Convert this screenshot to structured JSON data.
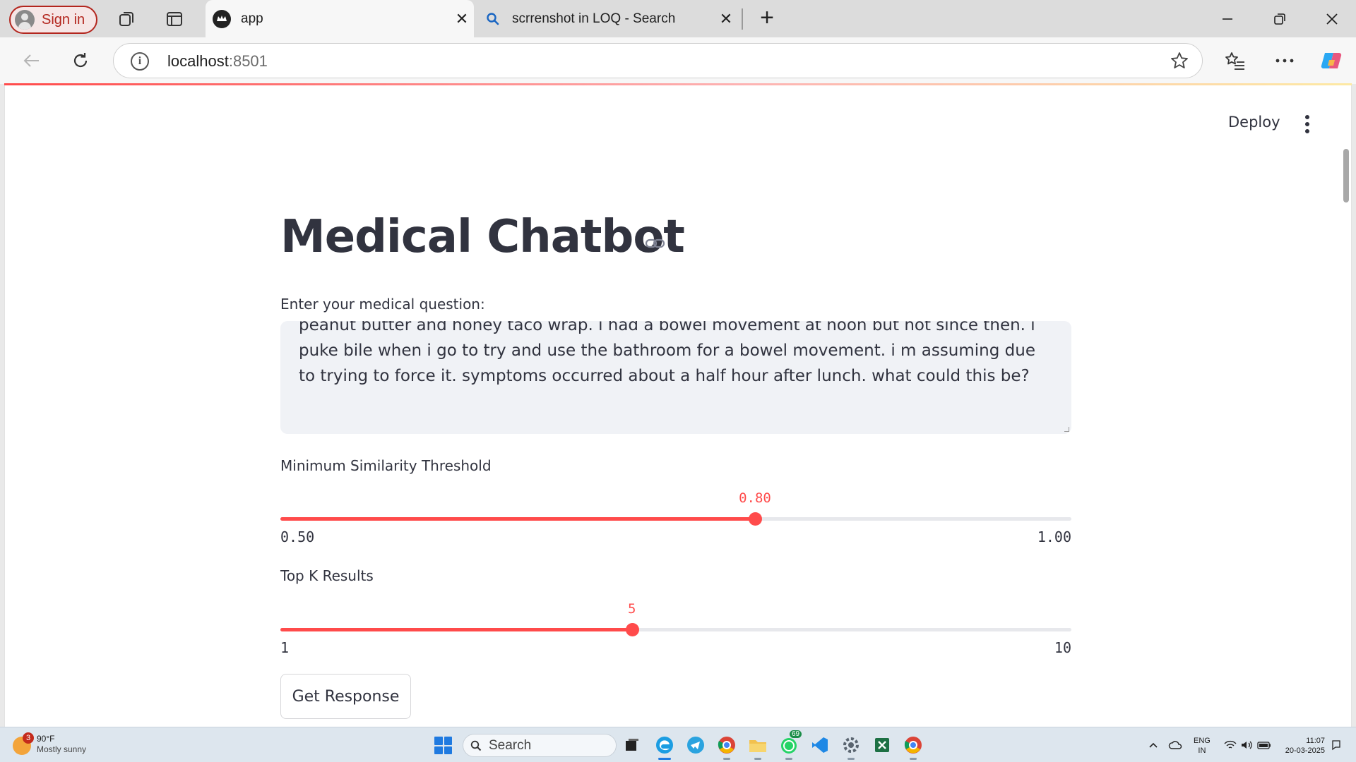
{
  "browser": {
    "profile_label": "Sign in",
    "tabs": [
      {
        "title": "app",
        "active": true,
        "icon": "streamlit-crown-icon"
      },
      {
        "title": "scrrenshot in LOQ - Search",
        "active": false,
        "icon": "search-icon"
      }
    ],
    "url_host": "localhost",
    "url_port": ":8501"
  },
  "app": {
    "deploy_label": "Deploy",
    "title": "Medical Chatbot",
    "question_label": "Enter your medical question:",
    "question_value": "peanut butter and honey taco wrap. i had a bowel movement at noon but not since then. i puke bile when i go to try and use the bathroom for a bowel movement. i m assuming due to trying to force it. symptoms occurred about a half hour after lunch. what could this be?",
    "similarity": {
      "label": "Minimum Similarity Threshold",
      "value_text": "0.80",
      "value": 0.8,
      "min_text": "0.50",
      "max_text": "1.00",
      "min": 0.5,
      "max": 1.0,
      "accent": "#ff4b4b"
    },
    "topk": {
      "label": "Top K Results",
      "value_text": "5",
      "value": 5,
      "min_text": "1",
      "max_text": "10",
      "min": 1,
      "max": 10,
      "accent": "#ff4b4b"
    },
    "button_label": "Get Response"
  },
  "taskbar": {
    "weather_badge": "3",
    "weather_temp": "90°F",
    "weather_cond": "Mostly sunny",
    "search_label": "Search",
    "whatsapp_badge": "69",
    "lang_1": "ENG",
    "lang_2": "IN",
    "time": "11:07",
    "date": "20-03-2025"
  }
}
